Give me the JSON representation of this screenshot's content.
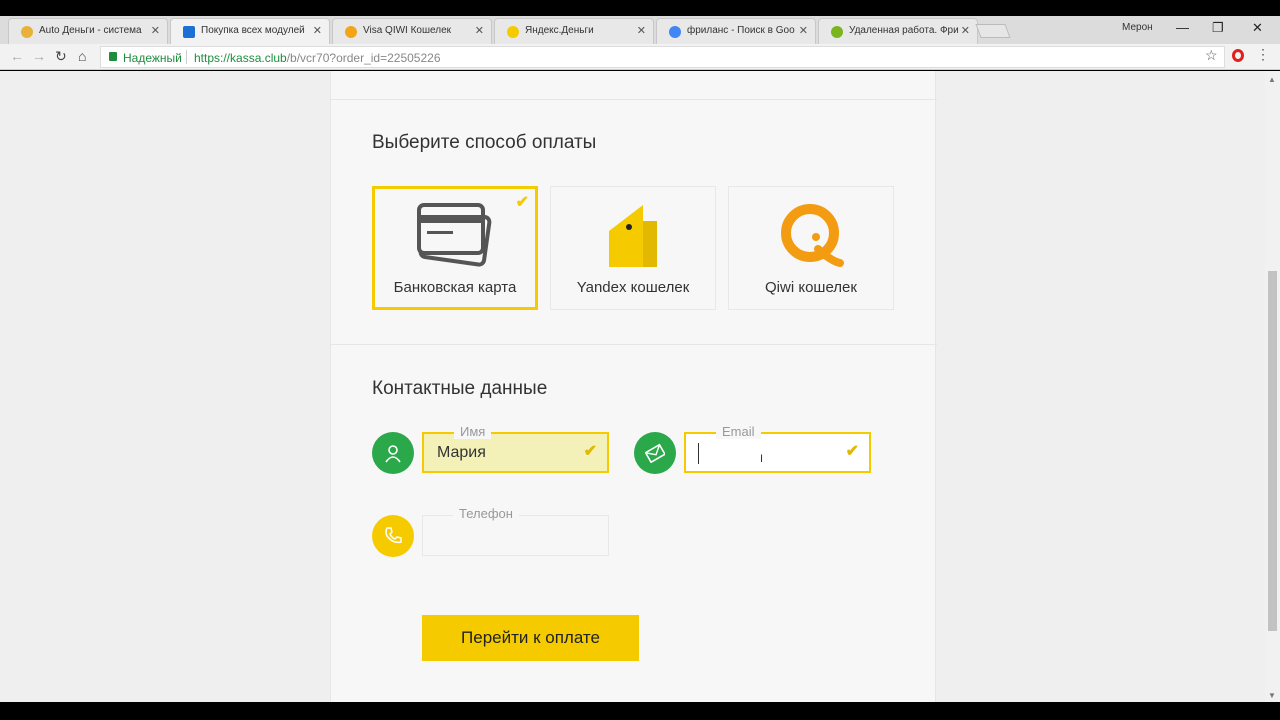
{
  "browser": {
    "tabs": [
      {
        "title": "Auto Деньги - система",
        "favicon_color": "#e8b13a"
      },
      {
        "title": "Покупка всех модулей",
        "favicon_color": "#1d6fd6"
      },
      {
        "title": "Visa QIWI Кошелек",
        "favicon_color": "#f3a51a"
      },
      {
        "title": "Яндекс.Деньги",
        "favicon_color": "#f5cb00"
      },
      {
        "title": "фриланс - Поиск в Goo",
        "favicon_color": "#4285f4"
      },
      {
        "title": "Удаленная работа. Фри",
        "favicon_color": "#7ab51d"
      }
    ],
    "tab_close": "✕",
    "user": "Мерон",
    "window_buttons": {
      "minimize": "—",
      "maximize": "❐",
      "close": "✕"
    },
    "address": {
      "secure_label": "Надежный",
      "url_host": "https://kassa.club",
      "url_path": "/b/vcr70?order_id=22505226"
    }
  },
  "page": {
    "payment_title": "Выберите способ оплаты",
    "payment_methods": [
      {
        "label": "Банковская карта",
        "icon": "bank-card-icon",
        "selected": true
      },
      {
        "label": "Yandex кошелек",
        "icon": "yandex-wallet-icon",
        "selected": false
      },
      {
        "label": "Qiwi кошелек",
        "icon": "qiwi-icon",
        "selected": false
      }
    ],
    "check_mark": "✔",
    "contacts_title": "Контактные данные",
    "fields": {
      "name": {
        "label": "Имя",
        "value": "Мария"
      },
      "email": {
        "label": "Email",
        "value": ""
      },
      "phone": {
        "label": "Телефон",
        "value": ""
      }
    },
    "submit_label": "Перейти к оплате"
  },
  "colors": {
    "accent": "#f5cb00",
    "green": "#2aa84a",
    "yellow_icon": "#f5cb00"
  }
}
